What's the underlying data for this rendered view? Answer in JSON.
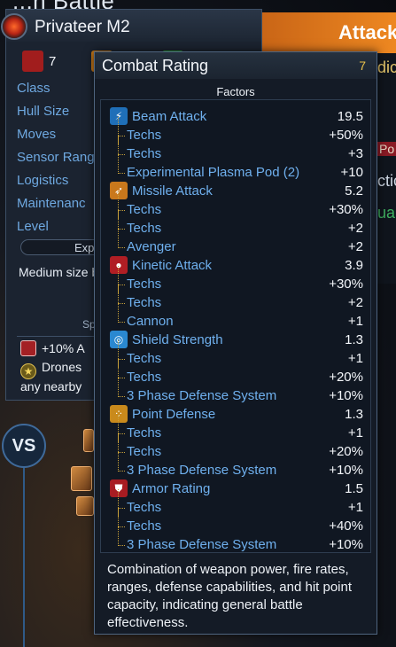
{
  "background": {
    "title_fragment": "...n Battle",
    "attack_banner": "Attack",
    "right_fragments": [
      "dic",
      "Po",
      "ctic",
      "ua"
    ]
  },
  "ship_panel": {
    "name": "Privateer M2",
    "chips": [
      {
        "value": "7",
        "color": "#a11d1d"
      },
      {
        "value": "",
        "color": "#c97a1a"
      },
      {
        "value": "",
        "color": "#2b9a3a"
      }
    ],
    "stats": [
      "Class",
      "Hull Size",
      "Moves",
      "Sensor Rang",
      "Logistics",
      "Maintenanc",
      "Level"
    ],
    "exp_label": "Exp",
    "description": "Medium size balanced ca the backbon",
    "special_label": "Sp",
    "abilities": [
      {
        "icon": "armor-icon",
        "text": "+10% A"
      },
      {
        "icon": "star-icon",
        "text": "Drones"
      },
      {
        "icon": "",
        "text": "any nearby"
      }
    ]
  },
  "vs_label": "VS",
  "tooltip": {
    "title": "Combat Rating",
    "value": "7",
    "factors_label": "Factors",
    "categories": [
      {
        "icon": "beam-attack-icon",
        "color": "#1f6fb8",
        "label": "Beam Attack",
        "value": "19.5",
        "items": [
          {
            "label": "Techs",
            "value": "+50%"
          },
          {
            "label": "Techs",
            "value": "+3"
          },
          {
            "label": "Experimental Plasma Pod (2)",
            "value": "+10"
          }
        ]
      },
      {
        "icon": "missile-attack-icon",
        "color": "#c9781c",
        "label": "Missile Attack",
        "value": "5.2",
        "items": [
          {
            "label": "Techs",
            "value": "+30%"
          },
          {
            "label": "Techs",
            "value": "+2"
          },
          {
            "label": "Avenger",
            "value": "+2"
          }
        ]
      },
      {
        "icon": "kinetic-attack-icon",
        "color": "#b01e24",
        "label": "Kinetic Attack",
        "value": "3.9",
        "items": [
          {
            "label": "Techs",
            "value": "+30%"
          },
          {
            "label": "Techs",
            "value": "+2"
          },
          {
            "label": "Cannon",
            "value": "+1"
          }
        ]
      },
      {
        "icon": "shield-strength-icon",
        "color": "#2a88d0",
        "label": "Shield Strength",
        "value": "1.3",
        "items": [
          {
            "label": "Techs",
            "value": "+1"
          },
          {
            "label": "Techs",
            "value": "+20%"
          },
          {
            "label": "3 Phase Defense System",
            "value": "+10%"
          }
        ]
      },
      {
        "icon": "point-defense-icon",
        "color": "#c98a1c",
        "label": "Point Defense",
        "value": "1.3",
        "items": [
          {
            "label": "Techs",
            "value": "+1"
          },
          {
            "label": "Techs",
            "value": "+20%"
          },
          {
            "label": "3 Phase Defense System",
            "value": "+10%"
          }
        ]
      },
      {
        "icon": "armor-rating-icon",
        "color": "#a81c22",
        "label": "Armor Rating",
        "value": "1.5",
        "items": [
          {
            "label": "Techs",
            "value": "+1"
          },
          {
            "label": "Techs",
            "value": "+40%"
          },
          {
            "label": "3 Phase Defense System",
            "value": "+10%"
          }
        ]
      }
    ],
    "description": "Combination of weapon power, fire rates, ranges, defense capabilities, and hit point capacity, indicating general battle effectiveness."
  }
}
